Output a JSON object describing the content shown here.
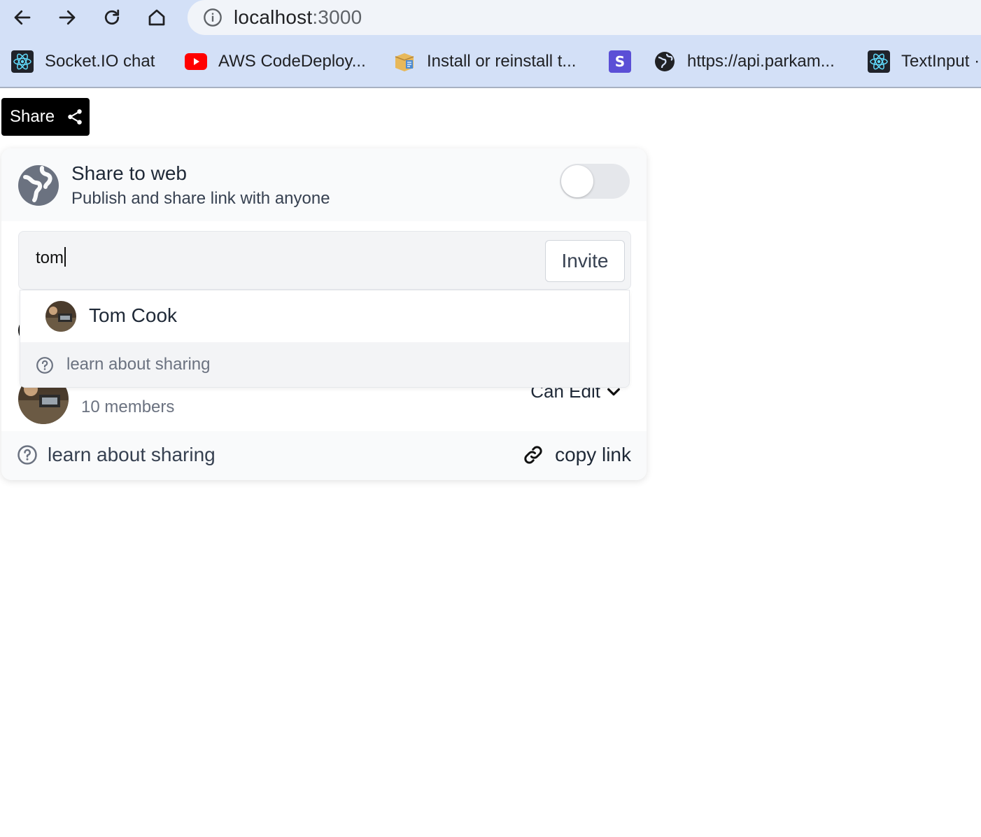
{
  "browser": {
    "url_host": "localhost",
    "url_port": ":3000",
    "bookmarks": [
      {
        "label": "Socket.IO chat",
        "icon": "react-atom-icon"
      },
      {
        "label": "AWS CodeDeploy...",
        "icon": "youtube-icon"
      },
      {
        "label": "Install or reinstall t...",
        "icon": "package-icon"
      },
      {
        "label": "",
        "icon": "s-app-icon"
      },
      {
        "label": "https://api.parkam...",
        "icon": "globe-icon"
      },
      {
        "label": "TextInput ·",
        "icon": "react-atom-icon"
      }
    ]
  },
  "share_button": {
    "label": "Share",
    "icon": "share-icon"
  },
  "panel": {
    "web_title": "Share to web",
    "web_subtitle": "Publish and share link with anyone",
    "toggle_on": false,
    "invite": {
      "value": "tom",
      "button": "Invite"
    },
    "member_row": {
      "subtitle": "10 members",
      "permission": "Can Edit"
    },
    "footer": {
      "learn": "learn about sharing",
      "copy": "copy link"
    }
  },
  "dropdown": {
    "suggestion": "Tom Cook",
    "footer": "learn about sharing"
  },
  "colors": {
    "accent_dark": "#000000",
    "chrome": "#d3e0f7",
    "panel_bg": "#f9fafb"
  }
}
